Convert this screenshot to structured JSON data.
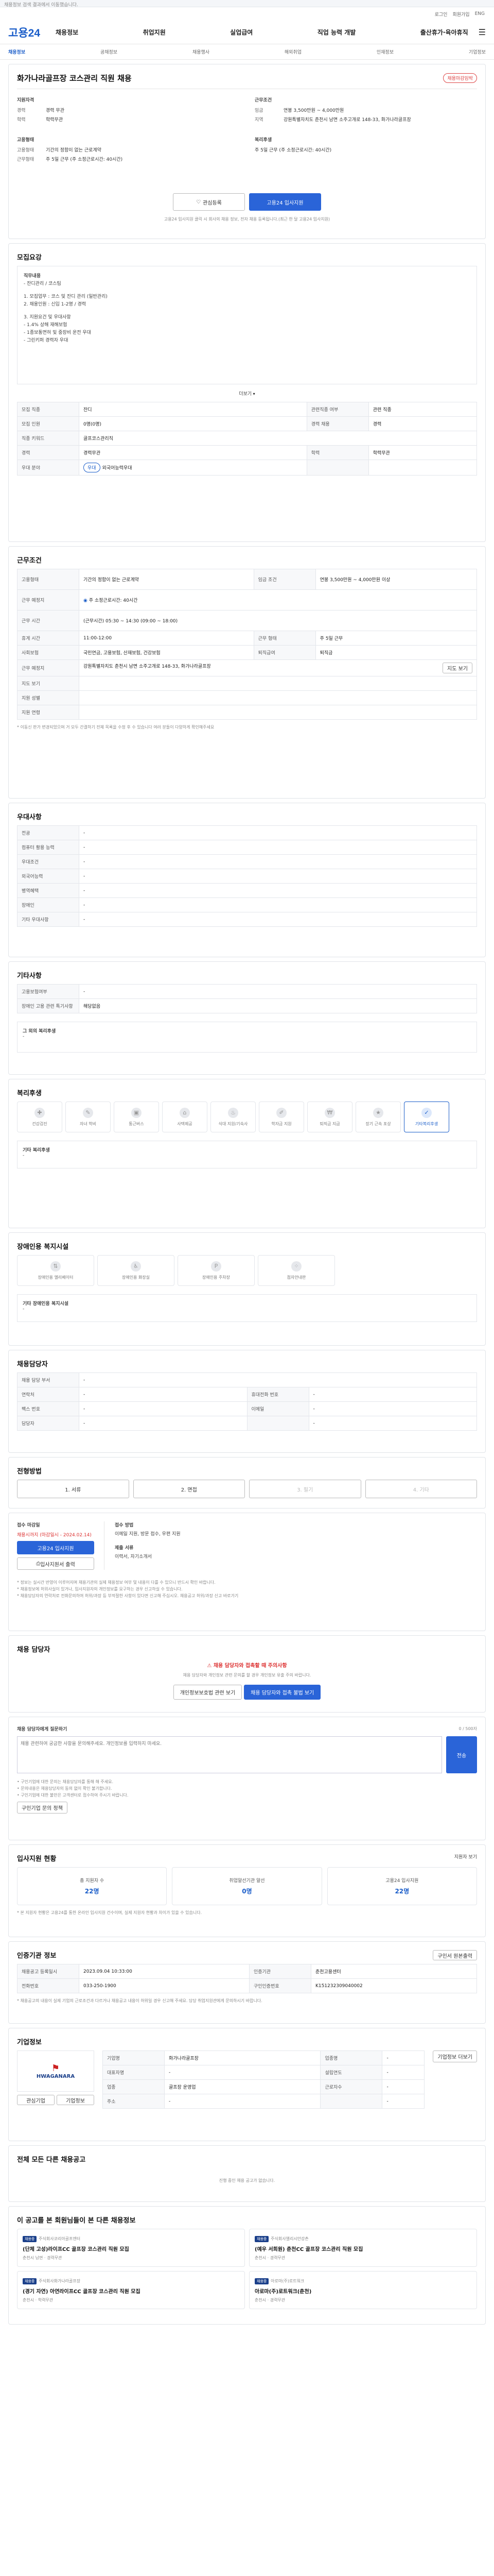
{
  "notice": "채용정보 검색 결과에서 이동했습니다.",
  "util": [
    "로그인",
    "회원가입",
    "ENG"
  ],
  "logo": "고용24",
  "gnb": [
    "채용정보",
    "취업지원",
    "실업급여",
    "직업 능력 개발",
    "출산휴가·육아휴직"
  ],
  "subnav": [
    "채용정보",
    "공채정보",
    "채용행사",
    "해외취업",
    "인재정보",
    "기업정보"
  ],
  "job": {
    "title": "화가나라골프장 코스관리 직원 채용",
    "badge": "채용마감임박",
    "company_h": "지원자격",
    "cond_h": "근무조건",
    "exp_k": "경력",
    "exp_v": "경력 무관",
    "edu_k": "학력",
    "edu_v": "학력무관",
    "pay_k": "임금",
    "pay_v": "연봉 3,500만원 ~ 4,000만원",
    "region_k": "지역",
    "region_v": "강원특별자치도 춘천시 남면 소주고개로 148-33, 화가나라골프장",
    "type_h": "고용형태",
    "type_v": "기간의 정함이 없는 근로계약",
    "time_h": "복리후생",
    "time_k": "근무형태",
    "time_v": "주 5일 근무 (주 소정근로시간: 40시간)",
    "save_label": "관심등록",
    "apply_label": "고용24 입사지원",
    "apply_note": "고용24 입사지원 클릭 시 회사의 채용 정보, 전자 채용 등록됩니다.(최근 한 달 고용24 입사지원)"
  },
  "detail": {
    "title": "모집요강",
    "desc": [
      "직무내용",
      "- 잔디관리 / 코스팀",
      "",
      "1. 모집업무 : 코스 및 잔디 관리 (일반관리)",
      "2. 채용인원 : 신입 1-2명 / 경력",
      "",
      "3. 지원요건 및 우대사항",
      "- 1.4% 상해 재해보험",
      "- 1종보통면허 및 중장비 운전 우대",
      "- 그린키퍼 경력자 우대"
    ],
    "more": "더보기",
    "rows": [
      [
        "모집 직종",
        "잔디",
        "관련직종 여부",
        "관련 직종"
      ],
      [
        "모집 인원",
        "0명(0명)",
        "경력 채용",
        "경력"
      ],
      [
        "직종 키워드",
        "골프코스관리직",
        null,
        null
      ],
      [
        "경력",
        "경력무관",
        "학력",
        "학력무관"
      ],
      [
        "우대 분야",
        "우대",
        "",
        "외국어능력우대"
      ]
    ]
  },
  "cond": {
    "title": "근무조건",
    "rows": [
      [
        "고용형태",
        "기간의 정함이 없는 근로계약",
        "임금 조건",
        "연봉 3,500만원 ~ 4,000만원 이상"
      ],
      [
        "근무 예정지",
        "주 소정근로시간: 40시간",
        "",
        ""
      ],
      [
        "근무 시간",
        "(근무시간) 05:30 ~ 14:30 (09:00 ~ 18:00)",
        "",
        ""
      ],
      [
        "휴게 시간",
        "11:00-12:00",
        "근무 형태",
        "주 5일 근무"
      ],
      [
        "사회보험",
        "국민연금, 고용보험, 산재보험, 건강보험",
        "퇴직급여",
        "퇴직금"
      ],
      [
        "근무 예정지",
        "강원특별자치도 춘천시 남면 소주고개로 148-33, 화가나라골프장",
        "",
        ""
      ],
      [
        "지도 보기",
        "",
        null,
        null
      ],
      [
        "지원 성별",
        "",
        null,
        null
      ],
      [
        "지원 연령",
        "",
        null,
        null
      ]
    ],
    "map_btn": "지도 보기",
    "note": "* 이동신 판가 변경되었으며 거 모두 간결하기 전체 목록을 수정 후 수 있습니다 여러 분들이 다양하게 확인해주세요"
  },
  "pref": {
    "title": "우대사항",
    "rows": [
      [
        "전공",
        ""
      ],
      [
        "컴퓨터 활용 능력",
        ""
      ],
      [
        "우대조건",
        ""
      ],
      [
        "외국어능력",
        ""
      ],
      [
        "병역혜택",
        ""
      ],
      [
        "장애인",
        ""
      ],
      [
        "기타 우대사항",
        ""
      ]
    ]
  },
  "docs": {
    "title": "기타사항",
    "rows": [
      [
        "고용보험여부",
        ""
      ],
      [
        "장애인 고용 관련 특기사항",
        "해당없음"
      ]
    ]
  },
  "other": {
    "title": "그 외의 복리후생",
    "value": "-"
  },
  "welfare": {
    "title": "복리후생",
    "items": [
      "건강검진",
      "자녀 학비",
      "통근버스",
      "사택제공",
      "식대 지원/기숙사",
      "학자금 지원",
      "퇴직금 지급",
      "장기 근속 포상",
      "기타복리후생"
    ],
    "sub_title": "기타 복리후생",
    "sub_value": "-"
  },
  "disab": {
    "title": "장애인용 복지시설",
    "items": [
      "장애인용 엘리베이터",
      "장애인용 화장실",
      "장애인용 주차장",
      "점자안내판"
    ],
    "sub_title": "기타 장애인용 복지시설",
    "sub_value": "-"
  },
  "contact": {
    "title": "채용담당자",
    "rows": [
      [
        "채용 담당 부서",
        "-",
        null,
        null
      ],
      [
        "연락처",
        "-",
        "휴대전화 번호",
        "-"
      ],
      [
        "팩스 번호",
        "-",
        "이메일",
        "-"
      ],
      [
        "담당자",
        "-",
        "",
        "-"
      ]
    ]
  },
  "method": {
    "title": "전형방법",
    "items": [
      "1. 서류",
      "2. 면접",
      "3. 필기",
      "4. 기타"
    ]
  },
  "apply": {
    "title": "접수 마감일",
    "deadline": "채용시까지 (마감일시 - 2024.02.14)",
    "online_btn": "고용24 입사지원",
    "print_btn": "입사지원서 출력",
    "method_h": "접수 방법",
    "method_v": "이메일 지원, 방문 접수, 우편 지원",
    "doc_h": "제출 서류",
    "doc_v": "이력서, 자기소개서",
    "notes": [
      "* 정보는 실시간 반영이 이루어지며 채용기관의 실제 채용정보 여부 및 내용이 다를 수 있으니 반드시 확인 바랍니다.",
      "* 채용정보에 허위사실이 있거나, 입사지원자의 개인정보를 요구하는 경우 신고하실 수 있습니다.",
      "* 채용담당자의 연락처로 전화문의하여 허위/과장 등 부적절한 사항이 있다면 신고해 주십시오. 채용공고 허위/과장 신고 바로가기"
    ]
  },
  "talk": {
    "title": "채용 담당자",
    "alert": "채용 담당자와 접촉할 때 주의사항",
    "alert_desc": "채용 담당자와 개인정보 관련 문의를 할 경우 개인정보 유출 주의 바랍니다.",
    "btn1": "개인정보보호법 관련 보기",
    "btn2": "채용 담당자와 접촉 불법 보기"
  },
  "qna": {
    "title": "채용 담당자에게 질문하기",
    "count": "0 / 500자",
    "placeholder": "채용 관련하여 궁금한 사항을 문의해주세요. 개인정보를 입력하지 마세요.",
    "submit": "전송",
    "notes": [
      "• 구인기업에 대한 문의는 채용담당자를 통해 해 주세요.",
      "• 문의내용은 채용담당자의 동의 없이 확인 불가합니다.",
      "• 구인기업에 대한 불만은 고객센터로 접수하여 주시기 바랍니다."
    ],
    "policy": "구인기업 문의 정책"
  },
  "stats": {
    "title": "입사지원 현황",
    "more": "지원자 보기",
    "items": [
      {
        "l": "총 지원자 수",
        "n": "22명"
      },
      {
        "l": "취업알선기관 알선",
        "n": "0명"
      },
      {
        "l": "고용24 입사지원",
        "n": "22명"
      }
    ],
    "note": "* 본 지원자 현황은 고용24를 통한 온라인 입사지원 건수이며, 실제 지원자 현황과 차이가 있을 수 있습니다."
  },
  "org": {
    "title": "인증기관 정보",
    "print": "구인서 원본출력",
    "rows": [
      [
        "채용공고 등록일시",
        "2023.09.04 10:33:00",
        "인증기관",
        "춘천고용센터"
      ],
      [
        "전화번호",
        "033-250-1900",
        "구인인증번호",
        "K151232309040002"
      ]
    ],
    "note": "* 채용공고의 내용이 실제 기업의 근로조건과 다르거나 채용공고 내용이 허위일 경우 신고해 주세요. 담당 취업지원관에게 문의하시기 바랍니다."
  },
  "company": {
    "title": "기업정보",
    "logo": "HWAGANARA",
    "btn1": "관심기업",
    "btn2": "기업정보",
    "rows": [
      [
        "기업명",
        "화가나라골프장",
        "업종명",
        "-"
      ],
      [
        "대표자명",
        "-",
        "설립연도",
        "-"
      ],
      [
        "업종",
        "골프장 운영업",
        "근로자수",
        "-"
      ],
      [
        "주소",
        "-",
        "",
        "-"
      ]
    ],
    "detail_btn": "기업정보 더보기"
  },
  "other_jobs": {
    "title": "전체 모든 다른 채용공고",
    "empty": "진행 중인 채용 공고가 없습니다."
  },
  "recommend": {
    "title": "이 공고를 본 회원님들이 본 다른 채용정보",
    "items": [
      {
        "tag": "채용중",
        "co": "주식회사코리아골프엔터",
        "t": "(단체 고성)라이프CC 골프장 코스관리 직원 모집",
        "m": "춘천시 남면 · 경력무관"
      },
      {
        "tag": "채용중",
        "co": "주식회사엘리시안강촌",
        "t": "(예우 서희원) 춘천CC 골프장 코스관리 직원 모집",
        "m": "춘천시 · 경력무관"
      },
      {
        "tag": "채용중",
        "co": "주식회사화가나라골프장",
        "t": "(경기 자연) 아연라이프CC 골프장 코스관리 직원 모집",
        "m": "춘천시 · 학력무관"
      },
      {
        "tag": "채용중",
        "co": "아로마(주)로트워크",
        "t": "아로마(주)로트워크(춘천)",
        "m": "춘천시 · 경력무관"
      }
    ]
  }
}
